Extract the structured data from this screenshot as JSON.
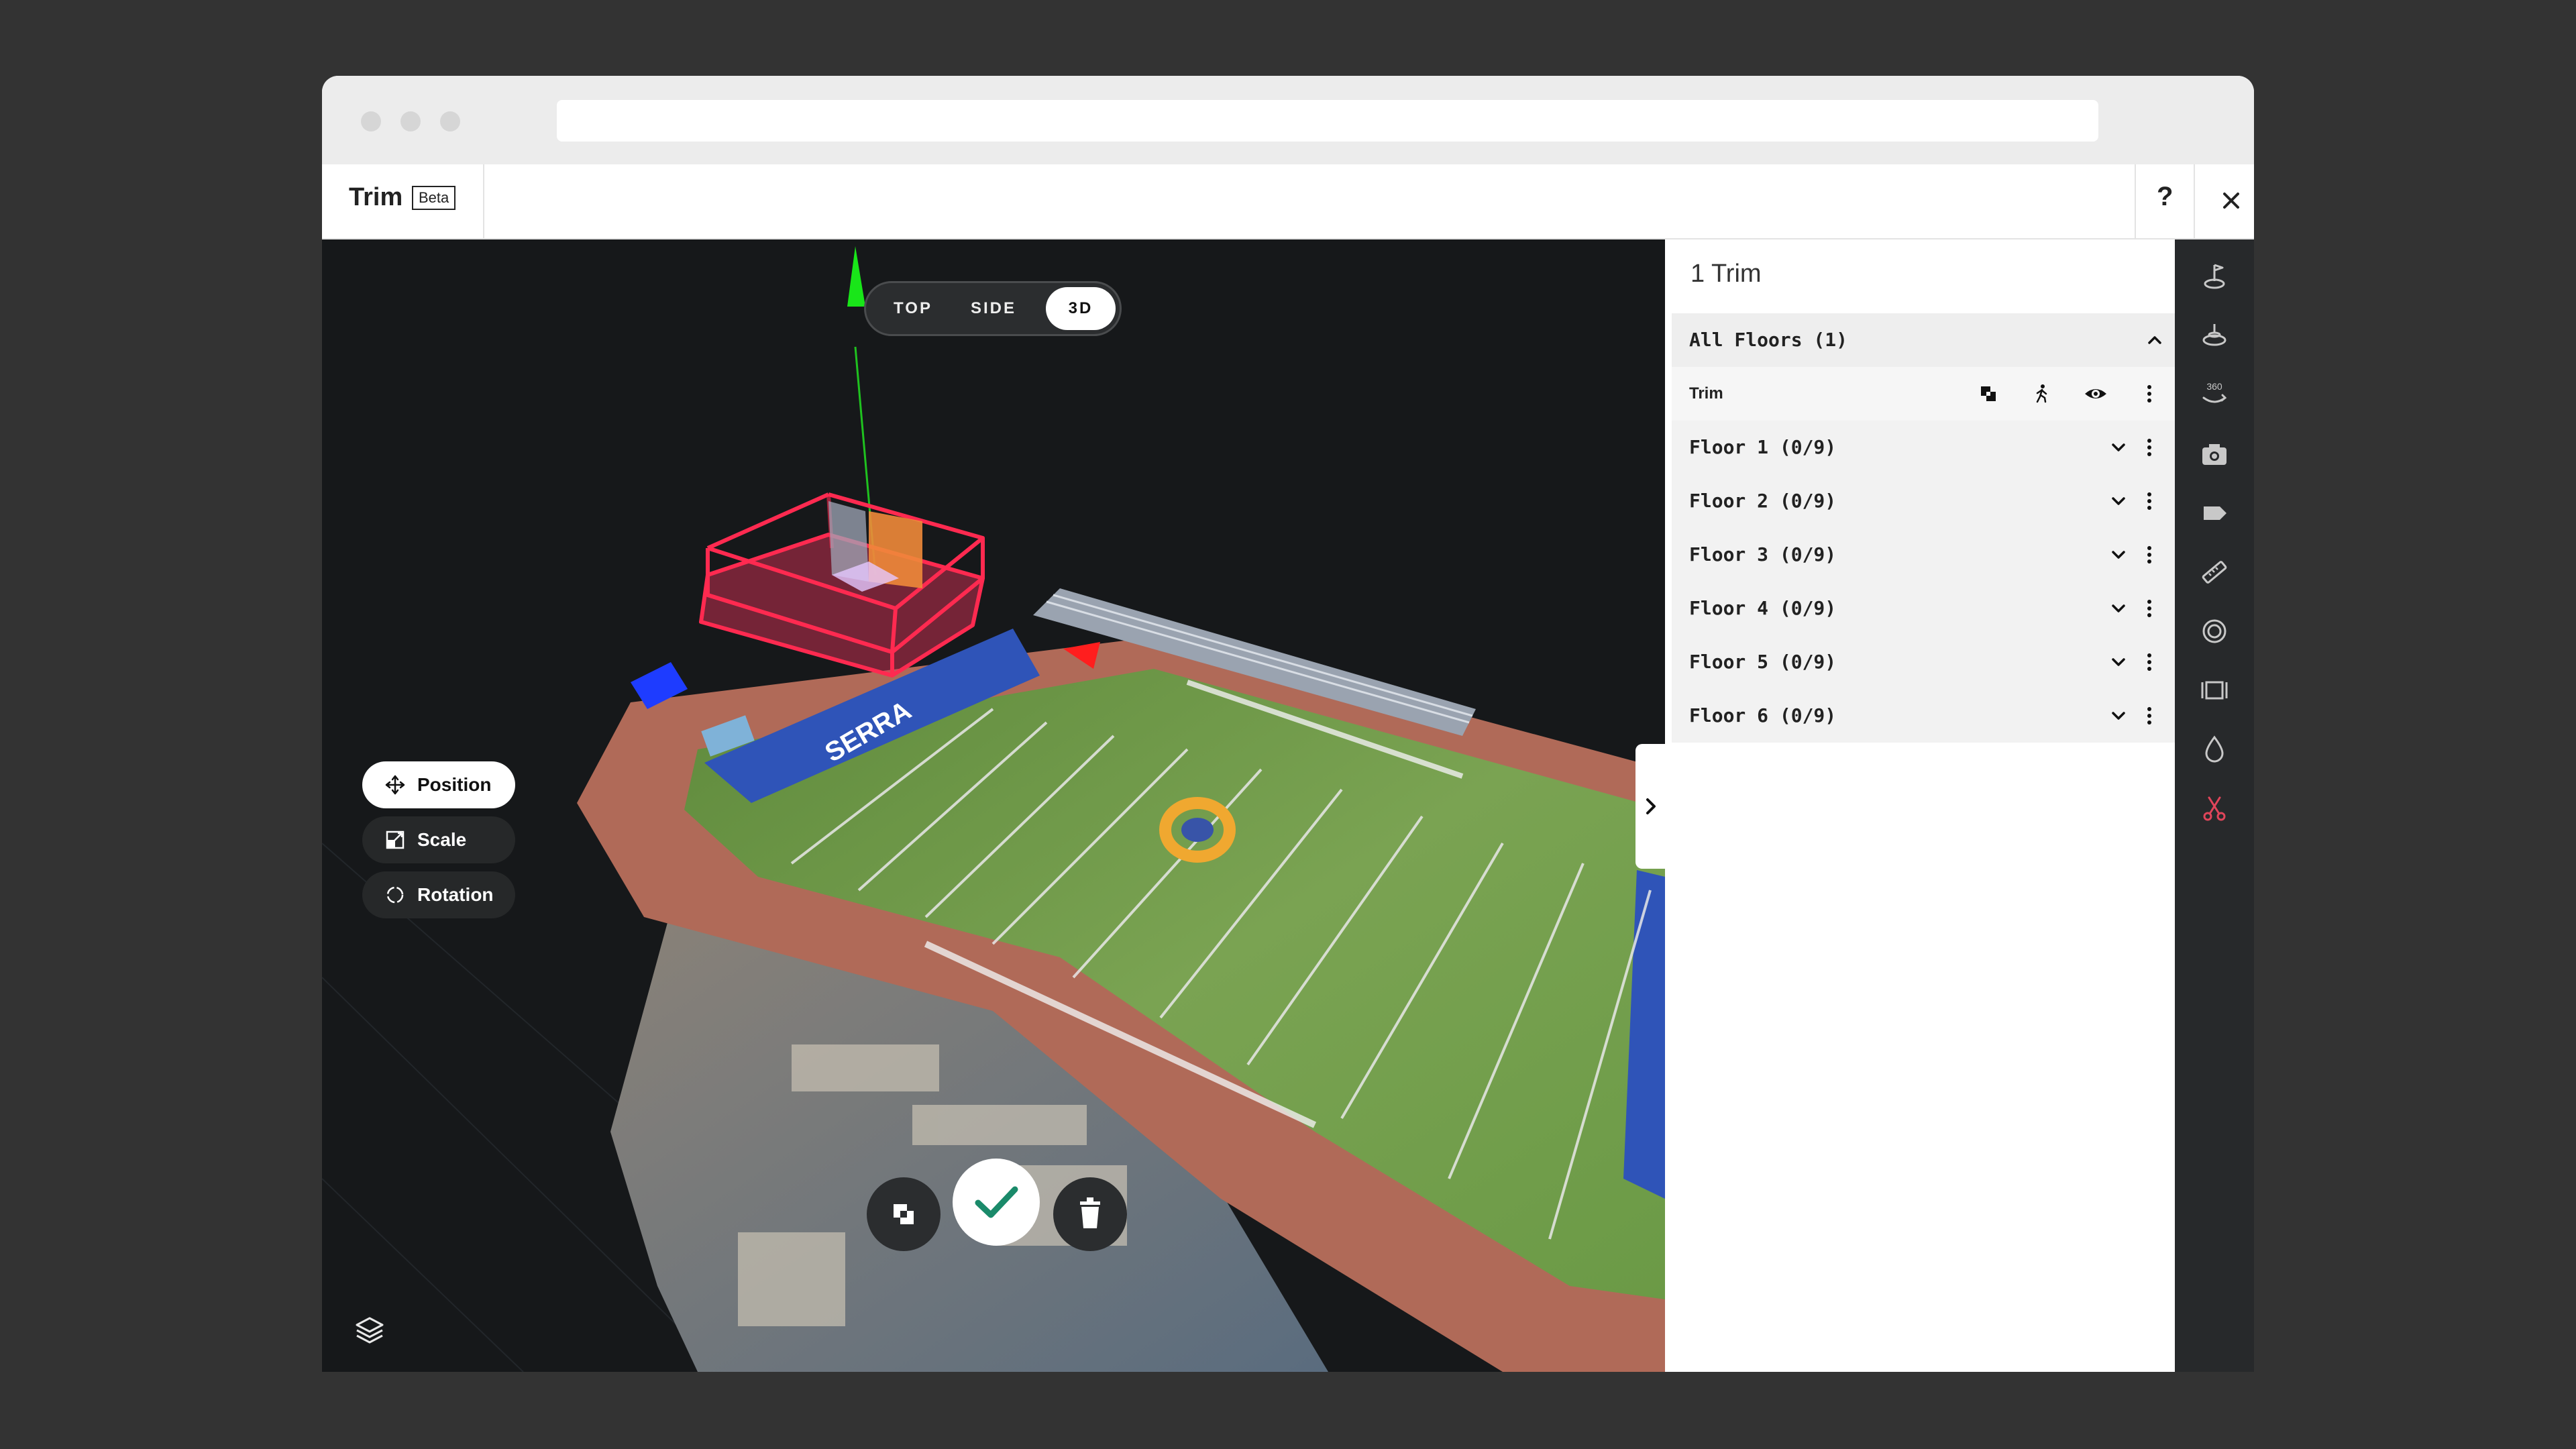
{
  "header": {
    "title": "Trim",
    "badge": "Beta",
    "help_label": "?"
  },
  "view_modes": [
    {
      "label": "TOP",
      "active": false
    },
    {
      "label": "SIDE",
      "active": false
    },
    {
      "label": "3D",
      "active": true
    }
  ],
  "transform_tools": [
    {
      "label": "Position",
      "icon": "move-icon",
      "active": true
    },
    {
      "label": "Scale",
      "icon": "scale-icon",
      "active": false
    },
    {
      "label": "Rotation",
      "icon": "rotate-icon",
      "active": false
    }
  ],
  "field_markings": {
    "end_zone_text": "SERRA"
  },
  "panel": {
    "title": "1 Trim",
    "group_label": "All Floors (1)",
    "trim_item_label": "Trim",
    "floors": [
      "Floor 1 (0/9)",
      "Floor 2 (0/9)",
      "Floor 3 (0/9)",
      "Floor 4 (0/9)",
      "Floor 5 (0/9)",
      "Floor 6 (0/9)"
    ]
  },
  "sidebar": {
    "icons": [
      "floor-tag-icon",
      "floor-plan-icon",
      "360-view-icon",
      "camera-icon",
      "tag-icon",
      "ruler-icon",
      "target-icon",
      "film-icon",
      "drop-icon",
      "scissors-icon",
      "settings-icon"
    ],
    "label_360": "360",
    "active_color": "#e0455a"
  },
  "colors": {
    "trim_box": "#ff3c5a",
    "confirm": "#1a8a6a",
    "axis_x": "#ff2a2a",
    "axis_y": "#19e619",
    "axis_z": "#2244ff"
  }
}
